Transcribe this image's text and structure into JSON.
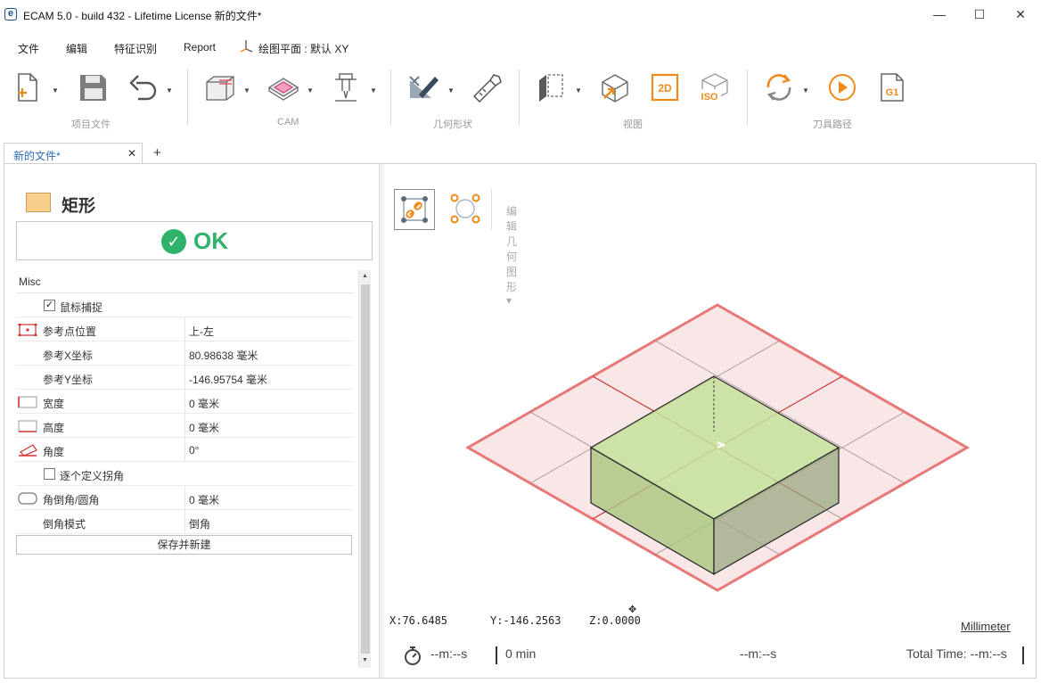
{
  "window": {
    "title": "ECAM 5.0 - build 432 - Lifetime License 新的文件*",
    "minimize": "—",
    "maximize": "☐",
    "close": "✕",
    "logo_letter": "e"
  },
  "menu": {
    "file": "文件",
    "edit": "编辑",
    "feature": "特征识别",
    "report": "Report",
    "plane": "绘图平面 : 默认 XY"
  },
  "ribbon": {
    "groups": {
      "project": "项目文件",
      "cam": "CAM",
      "geometry": "几何形状",
      "view": "视图",
      "toolpath": "刀具路径"
    },
    "icons": {
      "new": "new-file-icon",
      "save": "save-icon",
      "undo": "undo-icon",
      "stock": "stock-icon",
      "machining": "machining-icon",
      "tool": "tool-icon",
      "sketch": "sketch-icon",
      "measure": "measure-icon",
      "view_side": "side-view-icon",
      "view_3d": "view-3d-icon",
      "view_2d": "view-2d-icon",
      "view_iso": "view-iso-icon",
      "regenerate": "regenerate-icon",
      "simulate": "simulate-icon",
      "gcode": "gcode-icon"
    },
    "label_2d": "2D",
    "label_iso": "ISO",
    "label_g1": "G1"
  },
  "tabs": {
    "doc_name": "新的文件*",
    "close": "✕",
    "add": "+"
  },
  "panel": {
    "shape_name": "矩形",
    "ok_label": "OK",
    "ok_icon": "✓",
    "section": "Misc",
    "snap": {
      "label": "鼠标捕捉",
      "checked": true,
      "mark": "✓"
    },
    "rows": [
      {
        "label": "参考点位置",
        "value": "上-左"
      },
      {
        "label": "参考X坐标",
        "value": "80.98638 毫米"
      },
      {
        "label": "参考Y坐标",
        "value": "-146.95754 毫米"
      },
      {
        "label": "宽度",
        "value": "0 毫米"
      },
      {
        "label": "高度",
        "value": "0 毫米"
      },
      {
        "label": "角度",
        "value": "0°"
      }
    ],
    "custom_corner": {
      "label": "逐个定义拐角",
      "checked": false
    },
    "rows2": [
      {
        "label": "角倒角/圆角",
        "value": "0 毫米"
      },
      {
        "label": "倒角模式",
        "value": "倒角"
      }
    ],
    "save_new": "保存并新建",
    "scroll_up": "▲",
    "scroll_down": "▼"
  },
  "viewport": {
    "edit_geometry": "编辑几何图形 ▾",
    "coords": {
      "x": "X:76.6485",
      "y": "Y:-146.2563",
      "z": "Z:0.0000"
    },
    "unit": "Millimeter",
    "cursor": "✥"
  },
  "status": {
    "timer1": "--m:--s",
    "minutes": "0 min",
    "timer2": "--m:--s",
    "total": "Total Time: --m:--s"
  },
  "colors": {
    "box_fill": "#c5e19b",
    "plane_border": "#e87878",
    "plane_fill": "#f9e6e6",
    "accent_orange": "#f08a1c",
    "ok_green": "#2fb36a"
  }
}
